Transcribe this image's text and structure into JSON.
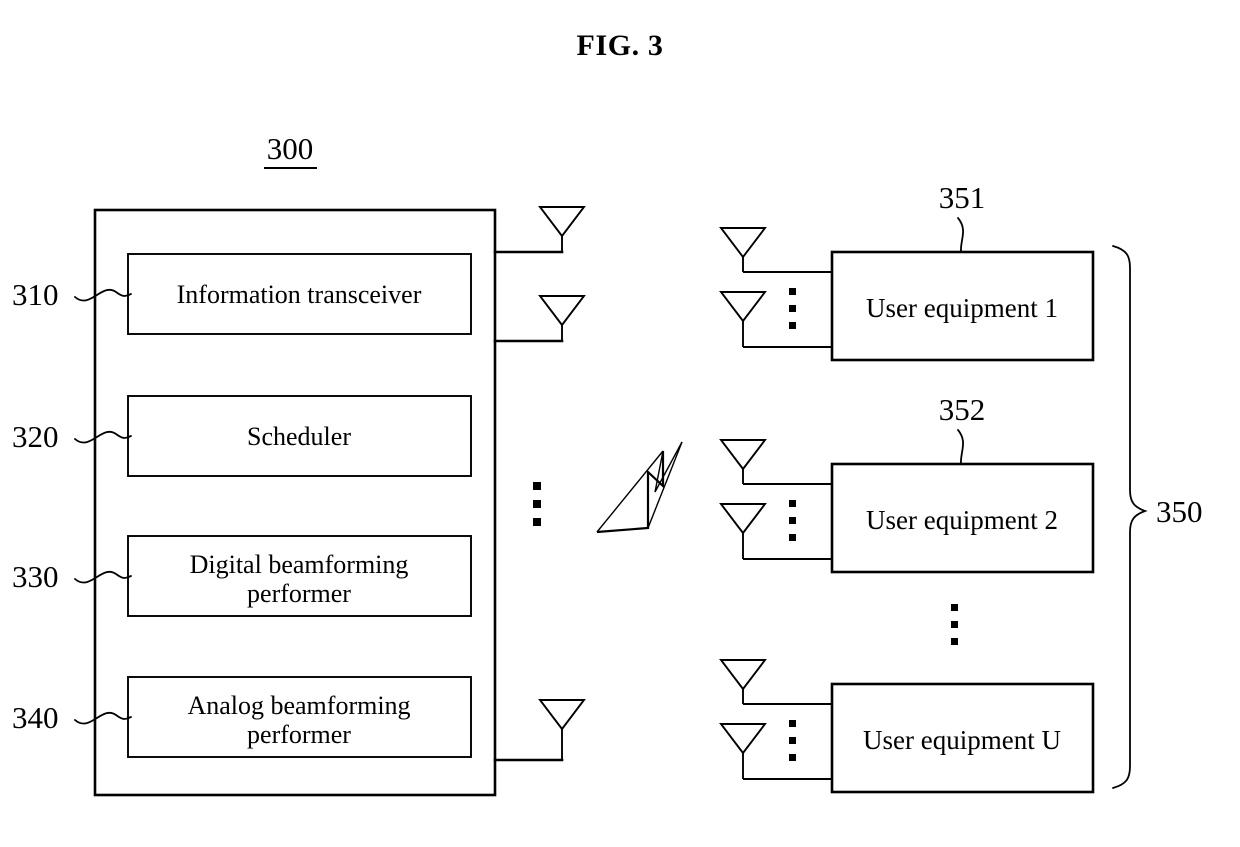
{
  "figure": {
    "title": "FIG. 3",
    "system_ref": "300",
    "ue_group_ref": "350"
  },
  "base_station": {
    "ref": "300",
    "modules": [
      {
        "ref": "310",
        "label": "Information transceiver"
      },
      {
        "ref": "320",
        "label": "Scheduler"
      },
      {
        "ref": "330",
        "label": "Digital beamforming performer",
        "line1": "Digital beamforming",
        "line2": "performer"
      },
      {
        "ref": "340",
        "label": "Analog beamforming performer",
        "line1": "Analog beamforming",
        "line2": "performer"
      }
    ],
    "antennas": {
      "icon": "antenna-icon",
      "count_shown": 3,
      "continuation": "vertical-ellipsis"
    }
  },
  "link": {
    "icon": "wireless-lightning-icon"
  },
  "user_equipments": {
    "group_ref": "350",
    "items": [
      {
        "ref": "351",
        "label": "User equipment 1"
      },
      {
        "ref": "352",
        "label": "User equipment 2"
      },
      {
        "ref": "",
        "label": "User equipment U"
      }
    ],
    "continuation": "vertical-ellipsis",
    "antenna_icon": "antenna-icon"
  }
}
